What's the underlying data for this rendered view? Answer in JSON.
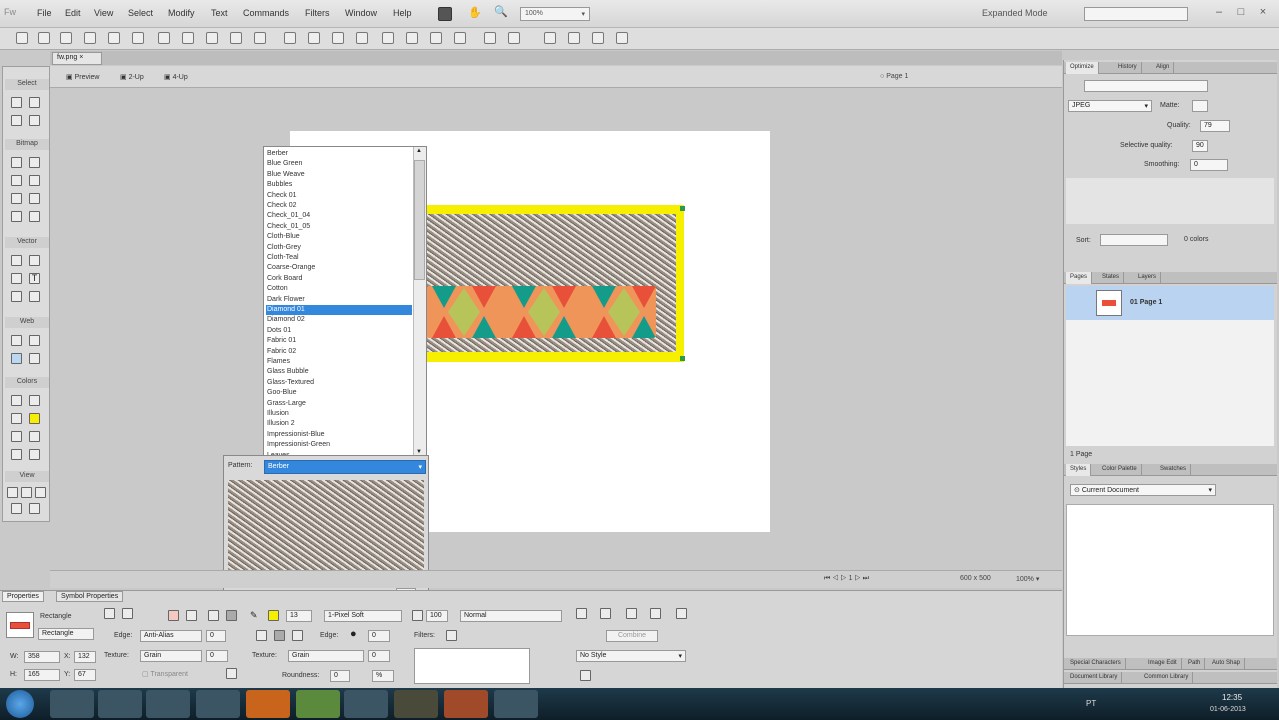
{
  "menu": {
    "items": [
      "File",
      "Edit",
      "View",
      "Select",
      "Modify",
      "Text",
      "Commands",
      "Filters",
      "Window",
      "Help"
    ],
    "zoom": "100%",
    "mode": "Expanded Mode"
  },
  "document": {
    "tab": "fw.png",
    "views": [
      "Preview",
      "2-Up",
      "4-Up"
    ],
    "page": "Page 1"
  },
  "tools": {
    "sections": [
      "Select",
      "Bitmap",
      "Vector",
      "Web",
      "Colors",
      "View"
    ]
  },
  "patterns": {
    "list": [
      "Berber",
      "Blue Green",
      "Blue Weave",
      "Bubbles",
      "Check 01",
      "Check 02",
      "Check_01_04",
      "Check_01_05",
      "Cloth-Blue",
      "Cloth-Grey",
      "Cloth-Teal",
      "Coarse-Orange",
      "Cork Board",
      "Cotton",
      "Dark Flower",
      "Diamond 01",
      "Diamond 02",
      "Dots 01",
      "Fabric 01",
      "Fabric 02",
      "Flames",
      "Glass Bubble",
      "Glass-Textured",
      "Goo-Blue",
      "Grass-Large",
      "Illusion",
      "Illusion 2",
      "Impressionist-Blue",
      "Impressionist-Green",
      "Leaves"
    ],
    "selected_index": 15,
    "label": "Pattern:",
    "current": "Berber",
    "value": "0"
  },
  "status": {
    "size": "600 x 500",
    "zoom": "100%",
    "frame": "1"
  },
  "optimize": {
    "tabs": [
      "Optimize",
      "History",
      "Align"
    ],
    "format": "JPEG",
    "matte_label": "Matte:",
    "quality_label": "Quality:",
    "quality": "79",
    "selective_label": "Selective quality:",
    "selective": "90",
    "smoothing_label": "Smoothing:",
    "smoothing": "0",
    "sort_label": "Sort:",
    "colors": "0 colors"
  },
  "pages": {
    "tabs": [
      "Pages",
      "States",
      "Layers"
    ],
    "item": "01  Page 1",
    "count": "1 Page"
  },
  "styles": {
    "tabs": [
      "Styles",
      "Color Palette",
      "Swatches"
    ],
    "current": "Current Document",
    "bottom_tabs": [
      "Special Characters",
      "Image Edit",
      "Path",
      "Auto Shap"
    ],
    "bottom_tabs2": [
      "Document Library",
      "Common Library"
    ]
  },
  "props": {
    "tabs": [
      "Properties",
      "Symbol Properties"
    ],
    "type": "Rectangle",
    "name": "Rectangle",
    "w": "358",
    "x": "132",
    "h": "165",
    "y": "67",
    "edge_label": "Edge:",
    "edge": "Anti-Alias",
    "edge_val": "0",
    "texture_label": "Texture:",
    "texture": "Grain",
    "texture_val": "0",
    "transparent": "Transparent",
    "stroke_size": "13",
    "stroke_type": "1-Pixel Soft",
    "edge2": "0",
    "texture2": "Grain",
    "texture2_val": "0",
    "roundness_label": "Roundness:",
    "roundness": "0",
    "roundness_unit": "%",
    "opacity": "100",
    "blend": "Normal",
    "filters_label": "Filters:",
    "combine": "Combine",
    "style": "No Style"
  },
  "taskbar": {
    "lang": "PT",
    "time": "12:35",
    "date": "01-06-2013"
  },
  "colors": {
    "accent": "#3388dd",
    "yellow": "#f7ef00",
    "orange": "#f0955a",
    "teal": "#149c8a",
    "olive": "#b7c45a",
    "red": "#e8503a"
  }
}
